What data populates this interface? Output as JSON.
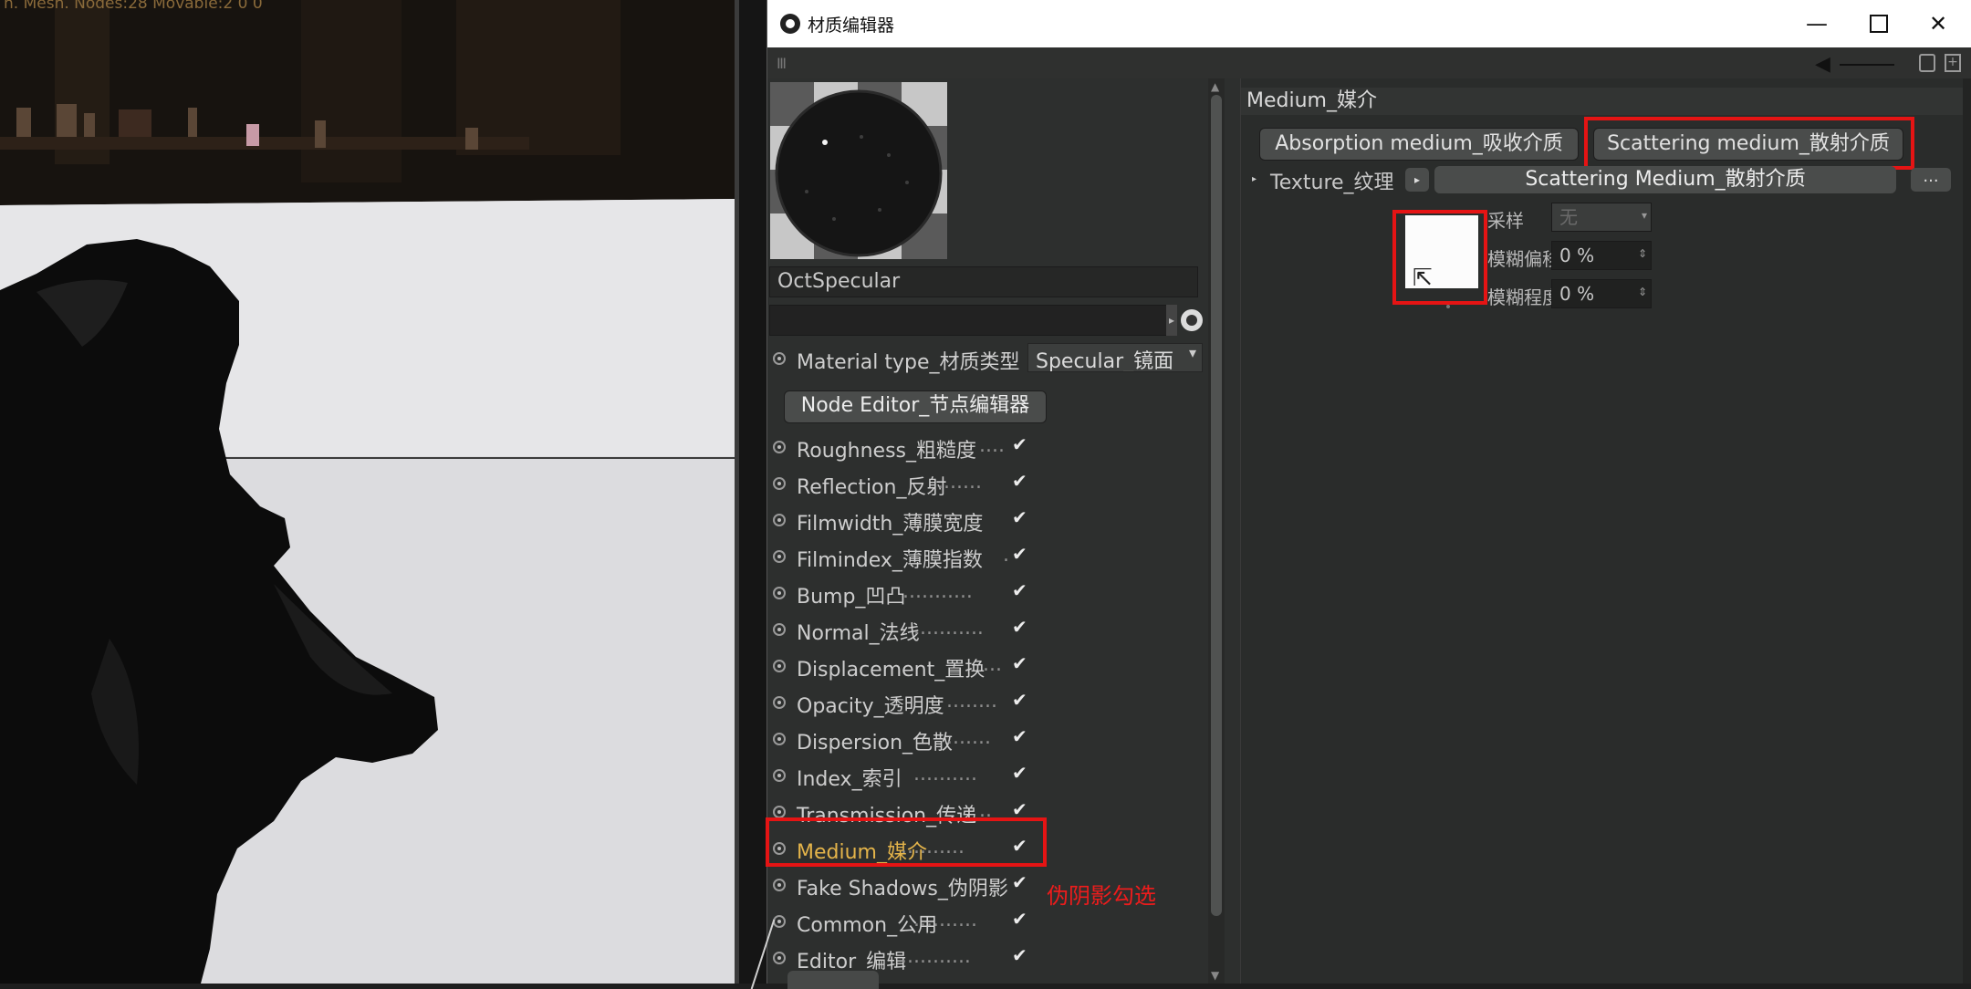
{
  "viewport": {
    "overlay_text": "h. Mesh. Nodes:28 Movable:2  0 0"
  },
  "window": {
    "title": "材质编辑器",
    "minimize": "—",
    "close": "✕"
  },
  "toolbar": {
    "grip": "Ⅲ",
    "arrow": "◀"
  },
  "material": {
    "name": "OctSpecular",
    "type_label": "Material type_材质类型",
    "type_value": "Specular_镜面",
    "node_editor_label": "Node Editor_节点编辑器"
  },
  "channels": [
    {
      "label": "Roughness_粗糙度",
      "dots": "....",
      "checked": "✔"
    },
    {
      "label": "Reflection_反射",
      "dots": ".......",
      "checked": "✔"
    },
    {
      "label": "Filmwidth_薄膜宽度",
      "dots": "",
      "checked": "✔"
    },
    {
      "label": "Filmindex_薄膜指数",
      "dots": ".",
      "checked": "✔"
    },
    {
      "label": "Bump_凹凸",
      "dots": "...........",
      "checked": "✔"
    },
    {
      "label": "Normal_法线",
      "dots": "...........",
      "checked": "✔"
    },
    {
      "label": "Displacement_置换",
      "dots": "...",
      "checked": "✔"
    },
    {
      "label": "Opacity_透明度",
      "dots": "........",
      "checked": "✔"
    },
    {
      "label": "Dispersion_色散",
      "dots": ".......",
      "checked": "✔"
    },
    {
      "label": "Index_索引",
      "dots": "..........",
      "checked": "✔"
    },
    {
      "label": "Transmission_传递",
      "dots": "..",
      "checked": "✔"
    },
    {
      "label": "Medium_媒介",
      "dots": "..........",
      "checked": "✔"
    },
    {
      "label": "Fake Shadows_伪阴影",
      "dots": "",
      "checked": "✔"
    },
    {
      "label": "Common_公用",
      "dots": "..........",
      "checked": "✔"
    },
    {
      "label": "Editor_编辑",
      "dots": "...........",
      "checked": "✔"
    }
  ],
  "annotation": {
    "note": "伪阴影勾选"
  },
  "medium_panel": {
    "title": "Medium_媒介",
    "tab_absorption": "Absorption medium_吸收介质",
    "tab_scattering": "Scattering medium_散射介质",
    "texture_label": "Texture_纹理",
    "texture_arrow": "▸",
    "texture_value": "Scattering Medium_散射介质",
    "texture_more": "...",
    "sampling_label": "采样",
    "sampling_value": "无",
    "blur_offset_label": "模糊偏移",
    "blur_offset_value": "0 %",
    "blur_scale_label": "模糊程度",
    "blur_scale_value": "0 %"
  },
  "colors": {
    "highlight": "#e51414",
    "active_channel": "#e4b44a",
    "panel_bg": "#2d2f2e"
  }
}
